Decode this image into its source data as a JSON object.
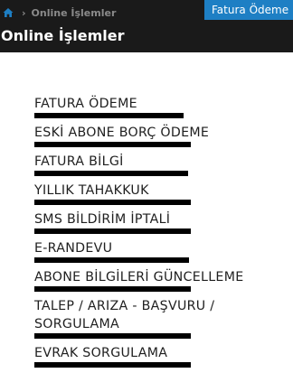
{
  "breadcrumb": {
    "home_icon": "home-icon",
    "separator": "›",
    "current": "Online İşlemler"
  },
  "header": {
    "top_tab_label": "Fatura Ödeme",
    "title": "Online İşlemler"
  },
  "colors": {
    "header_bg": "#1a1a1a",
    "accent_blue": "#1e7fc4",
    "underline": "#000000"
  },
  "menu": {
    "items": [
      {
        "label": "FATURA ÖDEME"
      },
      {
        "label": "ESKİ ABONE BORÇ ÖDEME"
      },
      {
        "label": "FATURA BİLGİ"
      },
      {
        "label": "YILLIK TAHAKKUK"
      },
      {
        "label": "SMS BİLDİRİM İPTALİ"
      },
      {
        "label": "E-RANDEVU"
      },
      {
        "label": "ABONE BİLGİLERİ GÜNCELLEME"
      },
      {
        "label": "TALEP / ARIZA - BAŞVURU / SORGULAMA"
      },
      {
        "label": "EVRAK SORGULAMA"
      }
    ]
  }
}
